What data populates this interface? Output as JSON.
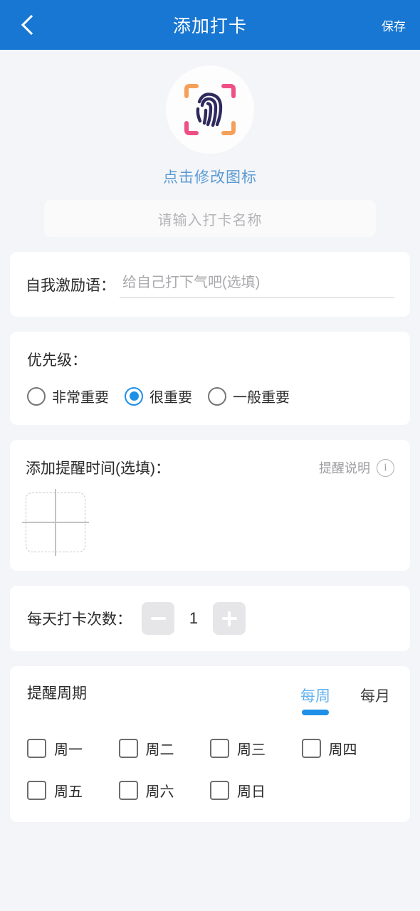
{
  "header": {
    "title": "添加打卡",
    "save_label": "保存",
    "back_icon": "chevron-left-icon",
    "bg_color": "#1877d2"
  },
  "icon_section": {
    "icon_name": "fingerprint-scan-icon",
    "caption": "点击修改图标",
    "caption_color": "#5b9bd5",
    "fingerprint_color": "#2e2a5e",
    "bracket_orange": "#f5a05a",
    "bracket_pink": "#ee4f86"
  },
  "name_field": {
    "placeholder": "请输入打卡名称",
    "value": ""
  },
  "motivation": {
    "label": "自我激励语：",
    "placeholder": "给自己打下气吧(选填)",
    "value": ""
  },
  "priority": {
    "title": "优先级：",
    "options": [
      {
        "label": "非常重要",
        "selected": false
      },
      {
        "label": "很重要",
        "selected": true
      },
      {
        "label": "一般重要",
        "selected": false
      }
    ],
    "accent_color": "#1e90e8"
  },
  "reminder_time": {
    "title": "添加提醒时间(选填)：",
    "hint_label": "提醒说明",
    "hint_icon": "info-circle-icon",
    "add_button_icon": "plus-icon"
  },
  "daily_count": {
    "label": "每天打卡次数：",
    "minus_icon": "minus-icon",
    "plus_icon": "plus-icon",
    "value": "1"
  },
  "cycle": {
    "title": "提醒周期",
    "tabs": [
      {
        "label": "每周",
        "active": true
      },
      {
        "label": "每月",
        "active": false
      }
    ],
    "days": [
      {
        "label": "周一",
        "checked": false
      },
      {
        "label": "周二",
        "checked": false
      },
      {
        "label": "周三",
        "checked": false
      },
      {
        "label": "周四",
        "checked": false
      },
      {
        "label": "周五",
        "checked": false
      },
      {
        "label": "周六",
        "checked": false
      },
      {
        "label": "周日",
        "checked": false
      }
    ]
  }
}
